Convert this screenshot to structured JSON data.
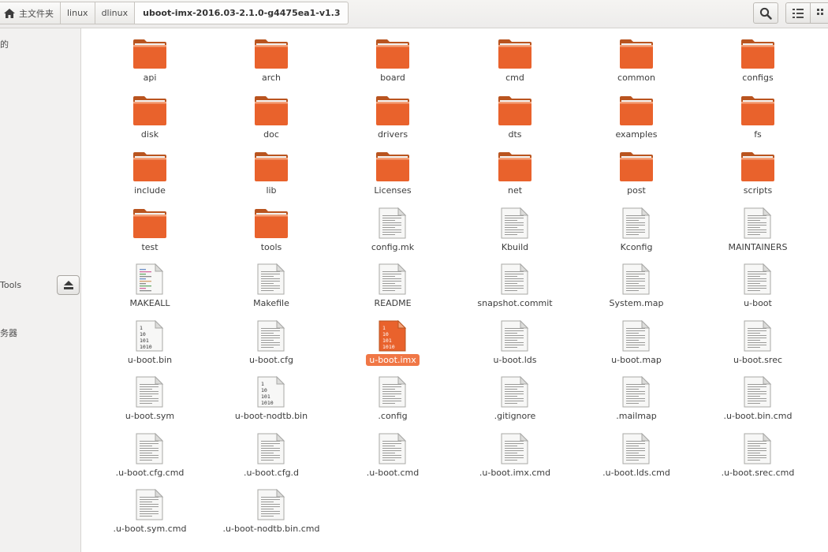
{
  "breadcrumb": {
    "home_label": "主文件夹",
    "items": [
      "linux",
      "dlinux"
    ],
    "current": "uboot-imx-2016.03-2.1.0-g4475ea1-v1.3"
  },
  "sidebar": {
    "items": [
      {
        "label": "的"
      },
      {
        "label": "Tools"
      },
      {
        "label": "务器"
      }
    ]
  },
  "files": [
    {
      "name": "api",
      "type": "folder"
    },
    {
      "name": "arch",
      "type": "folder"
    },
    {
      "name": "board",
      "type": "folder"
    },
    {
      "name": "cmd",
      "type": "folder"
    },
    {
      "name": "common",
      "type": "folder"
    },
    {
      "name": "configs",
      "type": "folder"
    },
    {
      "name": "disk",
      "type": "folder"
    },
    {
      "name": "doc",
      "type": "folder"
    },
    {
      "name": "drivers",
      "type": "folder"
    },
    {
      "name": "dts",
      "type": "folder"
    },
    {
      "name": "examples",
      "type": "folder"
    },
    {
      "name": "fs",
      "type": "folder"
    },
    {
      "name": "include",
      "type": "folder"
    },
    {
      "name": "lib",
      "type": "folder"
    },
    {
      "name": "Licenses",
      "type": "folder"
    },
    {
      "name": "net",
      "type": "folder"
    },
    {
      "name": "post",
      "type": "folder"
    },
    {
      "name": "scripts",
      "type": "folder"
    },
    {
      "name": "test",
      "type": "folder"
    },
    {
      "name": "tools",
      "type": "folder"
    },
    {
      "name": "config.mk",
      "type": "text"
    },
    {
      "name": "Kbuild",
      "type": "text"
    },
    {
      "name": "Kconfig",
      "type": "text"
    },
    {
      "name": "MAINTAINERS",
      "type": "text"
    },
    {
      "name": "MAKEALL",
      "type": "script"
    },
    {
      "name": "Makefile",
      "type": "text"
    },
    {
      "name": "README",
      "type": "text"
    },
    {
      "name": "snapshot.commit",
      "type": "text"
    },
    {
      "name": "System.map",
      "type": "text"
    },
    {
      "name": "u-boot",
      "type": "text"
    },
    {
      "name": "u-boot.bin",
      "type": "binary"
    },
    {
      "name": "u-boot.cfg",
      "type": "text"
    },
    {
      "name": "u-boot.imx",
      "type": "binary",
      "selected": true
    },
    {
      "name": "u-boot.lds",
      "type": "text"
    },
    {
      "name": "u-boot.map",
      "type": "text"
    },
    {
      "name": "u-boot.srec",
      "type": "text"
    },
    {
      "name": "u-boot.sym",
      "type": "text"
    },
    {
      "name": "u-boot-nodtb.bin",
      "type": "binary"
    },
    {
      "name": ".config",
      "type": "text"
    },
    {
      "name": ".gitignore",
      "type": "text"
    },
    {
      "name": ".mailmap",
      "type": "text"
    },
    {
      "name": ".u-boot.bin.cmd",
      "type": "text"
    },
    {
      "name": ".u-boot.cfg.cmd",
      "type": "text"
    },
    {
      "name": ".u-boot.cfg.d",
      "type": "text"
    },
    {
      "name": ".u-boot.cmd",
      "type": "text"
    },
    {
      "name": ".u-boot.imx.cmd",
      "type": "text"
    },
    {
      "name": ".u-boot.lds.cmd",
      "type": "text"
    },
    {
      "name": ".u-boot.srec.cmd",
      "type": "text"
    },
    {
      "name": ".u-boot.sym.cmd",
      "type": "text"
    },
    {
      "name": ".u-boot-nodtb.bin.cmd",
      "type": "text"
    }
  ],
  "binary_icon_text": [
    "1",
    "10",
    "101",
    "1010"
  ],
  "colors": {
    "folder": "#e9622c",
    "selection": "#f07746"
  }
}
